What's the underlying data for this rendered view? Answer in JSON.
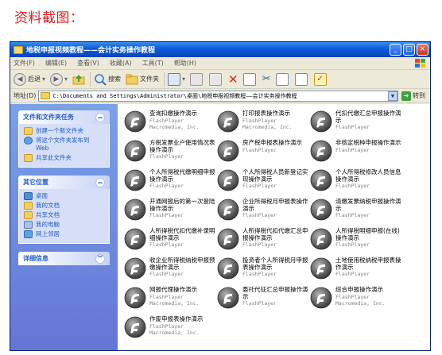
{
  "caption": "资料截图：",
  "window": {
    "title": "地税申报视频教程——会计实务操作教程",
    "min": "_",
    "max": "□",
    "close": "×"
  },
  "menu": [
    "文件(F)",
    "编辑(E)",
    "查看(V)",
    "收藏(A)",
    "工具(T)",
    "帮助(H)"
  ],
  "toolbar": {
    "back": "后退",
    "search": "搜索",
    "folders": "文件夹"
  },
  "address": {
    "label": "地址(D)",
    "path": "C:\\Documents and Settings\\Administrator\\桌面\\地税申报视频教程——会计实务操作教程",
    "go": "转到"
  },
  "taskpane": {
    "file_tasks_title": "文件和文件夹任务",
    "file_tasks": [
      "创建一个新文件夹",
      "将这个文件夹发布到 Web",
      "共享此文件夹"
    ],
    "other_places_title": "其它位置",
    "other_places": [
      "桌面",
      "我的文档",
      "共享文档",
      "我的电脑",
      "网上邻居"
    ],
    "details_title": "详细信息"
  },
  "files": [
    {
      "name": "查询扣缴操作演示",
      "type": "FlashPlayer",
      "company": "Macromedia, Inc."
    },
    {
      "name": "打印报表操作演示",
      "type": "FlashPlayer",
      "company": "Macromedia, Inc."
    },
    {
      "name": "代扣代缴汇总申报操作演示",
      "type": "FlashPlayer",
      "company": ""
    },
    {
      "name": "方税发票业户使用情况表操作演示",
      "type": "FlashPlayer",
      "company": ""
    },
    {
      "name": "房产税申报表操作演示",
      "type": "FlashPlayer",
      "company": ""
    },
    {
      "name": "非核定税种申报操作演示",
      "type": "FlashPlayer",
      "company": ""
    },
    {
      "name": "个人所得税代缴明细申报操作演示",
      "type": "FlashPlayer",
      "company": ""
    },
    {
      "name": "个人所得税人员新登记实现操作演示",
      "type": "FlashPlayer",
      "company": ""
    },
    {
      "name": "个人所得税修改人员信息操作演示",
      "type": "FlashPlayer",
      "company": ""
    },
    {
      "name": "开通网报后的第一次登陆操作演示",
      "type": "FlashPlayer",
      "company": ""
    },
    {
      "name": "企业所得税月申报表操作演示",
      "type": "FlashPlayer",
      "company": ""
    },
    {
      "name": "清缴发票纳税申报操作演示",
      "type": "FlashPlayer",
      "company": ""
    },
    {
      "name": "人所得税代扣代缴补录明细操作演示",
      "type": "FlashPlayer",
      "company": ""
    },
    {
      "name": "人所得税代扣代缴汇总申报操作演示",
      "type": "FlashPlayer",
      "company": ""
    },
    {
      "name": "人所得税明细申报(在线)操作演示",
      "type": "FlashPlayer",
      "company": ""
    },
    {
      "name": "收企业所得税纳税申报预缴操作演示",
      "type": "FlashPlayer",
      "company": ""
    },
    {
      "name": "投资者个人所得税月申报表操作演示",
      "type": "FlashPlayer",
      "company": ""
    },
    {
      "name": "土地使用税纳税申报表操作演示",
      "type": "FlashPlayer",
      "company": ""
    },
    {
      "name": "网报代理操作演示",
      "type": "FlashPlayer",
      "company": "Macromedia, Inc."
    },
    {
      "name": "委托代征汇总申报操作演示",
      "type": "FlashPlayer",
      "company": ""
    },
    {
      "name": "综合申报操作演示",
      "type": "FlashPlayer",
      "company": "Macromedia, Inc."
    },
    {
      "name": "作废申报表操作演示",
      "type": "FlashPlayer",
      "company": "Macromedia, Inc."
    }
  ],
  "colors": {
    "caption": "#e02020",
    "titlebar": "#0a5bd8",
    "taskpane": "#6f8fdd",
    "task_link": "#215dc6"
  },
  "icons": {
    "file": "flash-player-icon"
  }
}
